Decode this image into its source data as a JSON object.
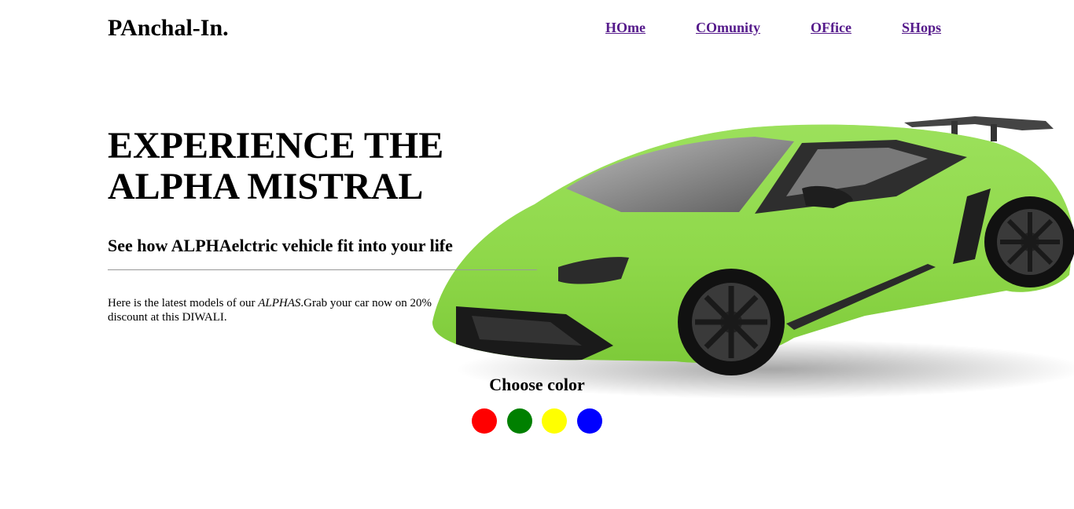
{
  "header": {
    "logo": "PAnchal-In.",
    "nav": [
      {
        "label": "HOme"
      },
      {
        "label": "COmunity"
      },
      {
        "label": "OFfice"
      },
      {
        "label": "SHops"
      }
    ],
    "link_color": "#551a8b"
  },
  "hero": {
    "title": "EXPERIENCE THE ALPHA MISTRAL",
    "subtitle": "See how ALPHAelctric vehicle fit into your life",
    "description_before": "Here is the latest models of our ",
    "description_em": "ALPHAS",
    "description_after": ".Grab your car now on 20% discount at this DIWALI."
  },
  "car": {
    "body_color": "#8fd84a",
    "icon": "car-image"
  },
  "color_picker": {
    "label": "Choose color",
    "colors": [
      {
        "name": "red",
        "hex": "#ff0000"
      },
      {
        "name": "green",
        "hex": "#008000"
      },
      {
        "name": "yellow",
        "hex": "#ffff00"
      },
      {
        "name": "blue",
        "hex": "#0000ff"
      }
    ]
  }
}
